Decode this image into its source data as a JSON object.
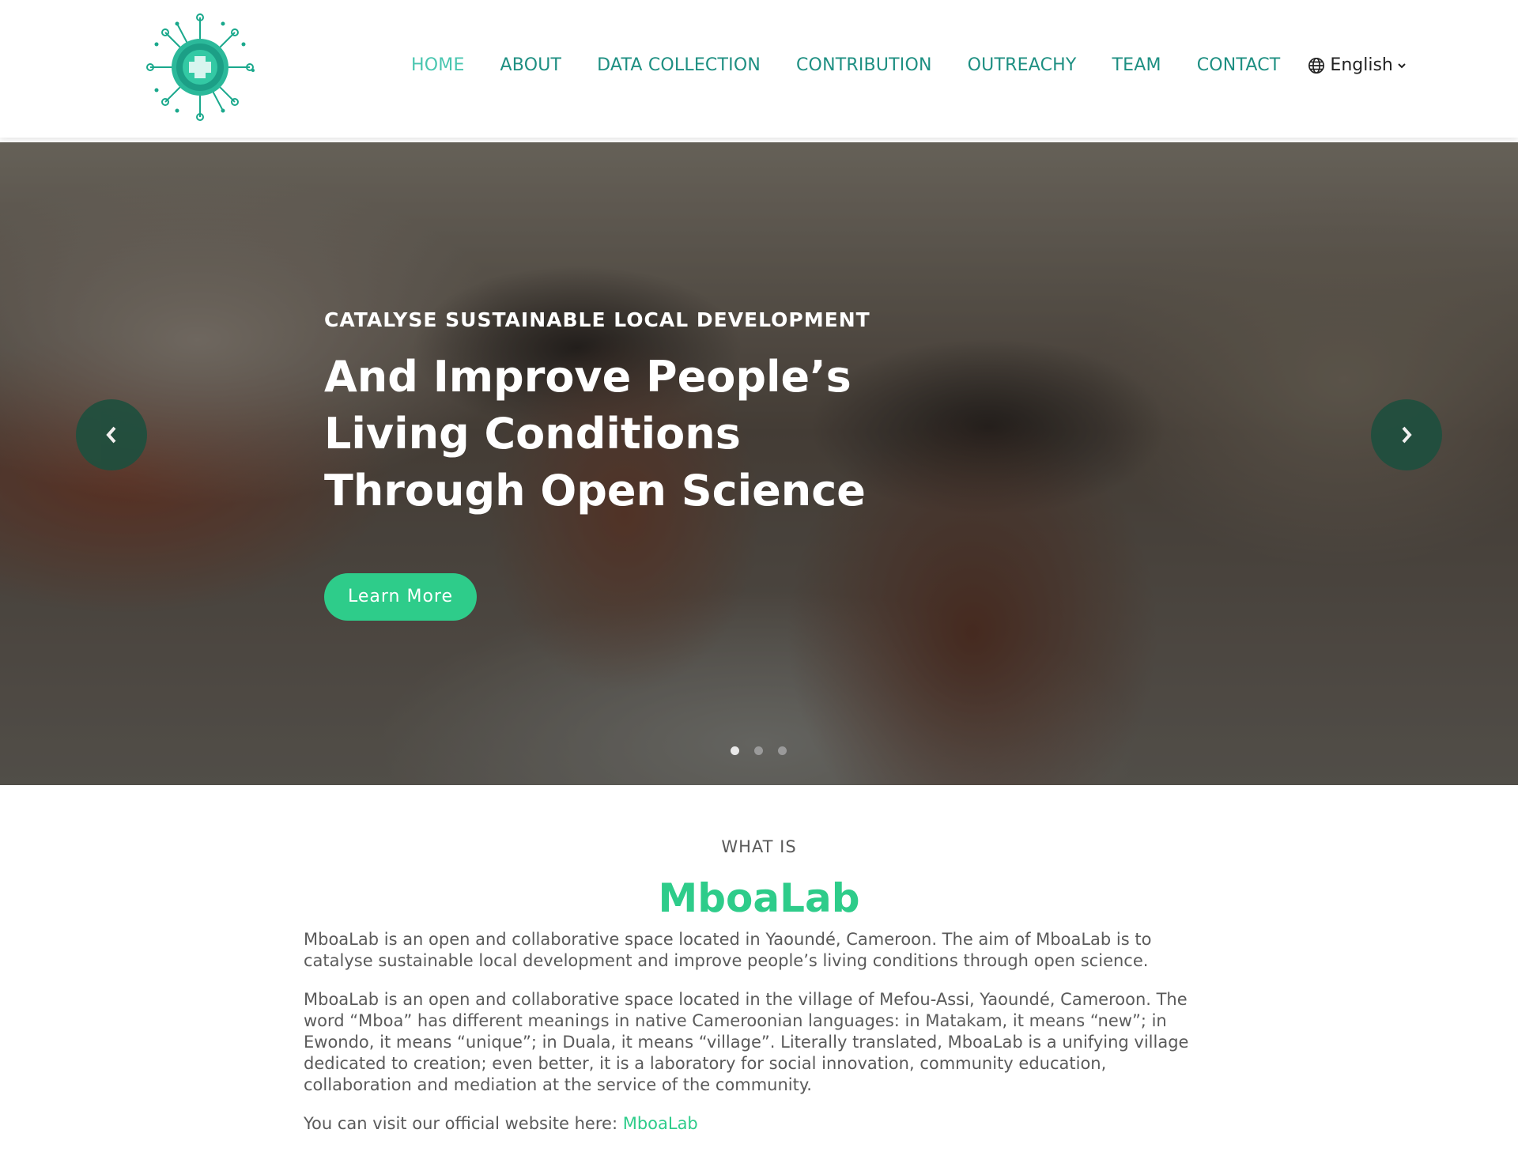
{
  "nav": {
    "items": [
      {
        "label": "HOME",
        "active": true
      },
      {
        "label": "ABOUT",
        "active": false
      },
      {
        "label": "DATA COLLECTION",
        "active": false
      },
      {
        "label": "CONTRIBUTION",
        "active": false
      },
      {
        "label": "OUTREACHY",
        "active": false
      },
      {
        "label": "TEAM",
        "active": false
      },
      {
        "label": "CONTACT",
        "active": false
      }
    ],
    "language": {
      "selected": "English",
      "icon": "globe-icon"
    }
  },
  "hero": {
    "kicker": "CATALYSE SUSTAINABLE LOCAL DEVELOPMENT",
    "title": "And Improve People’s Living Conditions Through Open Science",
    "button_label": "Learn More",
    "slides_count": 3,
    "active_slide": 1,
    "prev_icon": "chevron-left-icon",
    "next_icon": "chevron-right-icon"
  },
  "about": {
    "kicker": "WHAT IS",
    "title": "MboaLab",
    "paragraph1": "MboaLab is an open and collaborative space located in Yaoundé, Cameroon. The aim of MboaLab is to catalyse sustainable local development and improve people’s living conditions through open science.",
    "paragraph2": "MboaLab is an open and collaborative space located in the village of Mefou-Assi, Yaoundé, Cameroon. The word “Mboa” has different meanings in native Cameroonian languages: in Matakam, it means “new”; in Ewondo, it means “unique”; in Duala, it means “village”. Literally translated, MboaLab is a unifying village dedicated to creation; even better, it is a laboratory for social innovation, community education, collaboration and mediation at the service of the community.",
    "visit_text": "You can visit our official website here: ",
    "visit_link": "MboaLab"
  },
  "colors": {
    "nav_text": "#1e8f82",
    "nav_active": "#49c6b0",
    "accent_green": "#2ecc8a",
    "kicker_blue": "#2bb6c4",
    "arrow_bg": "#1f4f3e"
  }
}
